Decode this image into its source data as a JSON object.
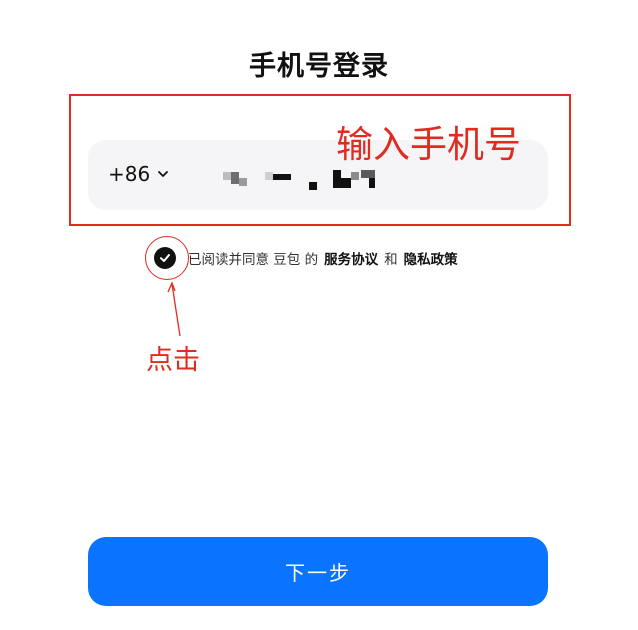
{
  "page": {
    "title": "手机号登录"
  },
  "phone": {
    "country_code": "+86",
    "number_masked": true
  },
  "agreement": {
    "checked": true,
    "prefix": "已阅读并同意 豆包 的",
    "terms_link": "服务协议",
    "and_text": "和",
    "privacy_link": "隐私政策"
  },
  "actions": {
    "next_label": "下一步"
  },
  "annotations": {
    "input_hint": "输入手机号",
    "click_hint": "点击"
  },
  "colors": {
    "accent": "#0a74ff",
    "annotation": "#e02b20",
    "field_bg": "#f5f5f7"
  }
}
